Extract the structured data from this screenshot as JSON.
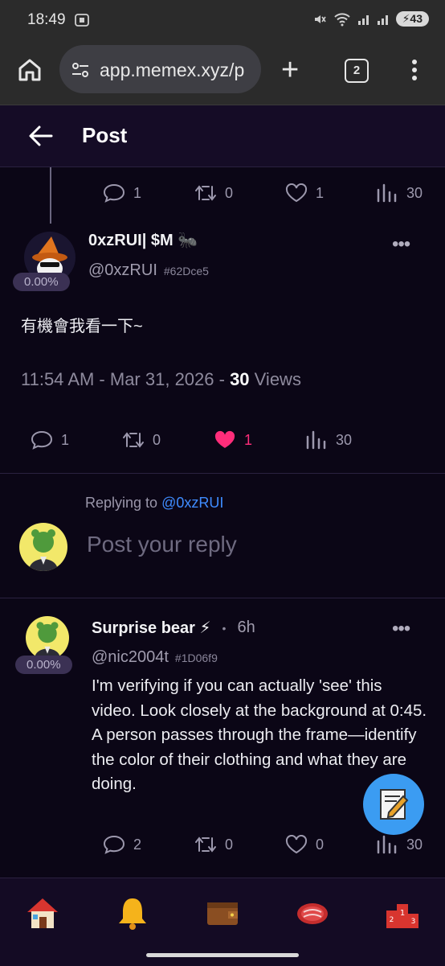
{
  "status_bar": {
    "time": "18:49",
    "battery": "43"
  },
  "browser": {
    "url": "app.memex.xyz/p",
    "tab_count": "2"
  },
  "header": {
    "title": "Post"
  },
  "parent_actions": {
    "comments": "1",
    "reposts": "0",
    "likes": "1",
    "views": "30"
  },
  "post": {
    "author_name": "0xzRUI| $M 🐜",
    "handle": "@0xzRUI",
    "hash": "#62Dce5",
    "percent": "0.00%",
    "text": "有機會我看一下~",
    "time": "11:54 AM - Mar 31, 2026 - ",
    "views_count": "30",
    "views_label": " Views",
    "actions": {
      "comments": "1",
      "reposts": "0",
      "likes": "1",
      "views": "30"
    }
  },
  "reply_box": {
    "replying_to_label": "Replying to ",
    "replying_to_handle": "@0xzRUI",
    "placeholder": "Post your reply"
  },
  "reply": {
    "author_name": "Surprise bear ⚡",
    "time_ago": "6h",
    "handle": "@nic2004t",
    "hash": "#1D06f9",
    "percent": "0.00%",
    "text": "I'm verifying if you can actually 'see' this video. Look closely at the background at 0:45. A person passes through the frame—identify the color of their clothing and what they are doing.",
    "actions": {
      "comments": "2",
      "reposts": "0",
      "likes": "0",
      "views": "30"
    }
  },
  "bottom_nav": [
    "home-icon",
    "bell-icon",
    "wallet-icon",
    "steak-icon",
    "leaderboard-icon"
  ],
  "colors": {
    "accent_blue": "#3b9cf2",
    "like_pink": "#ff2d7a",
    "background": "#0b0616"
  }
}
